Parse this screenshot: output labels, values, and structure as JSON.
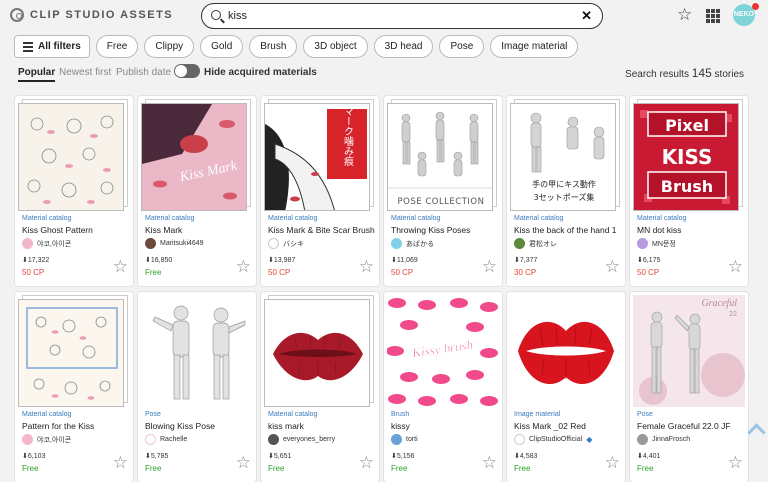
{
  "header": {
    "brand": "CLIP STUDIO ASSETS",
    "search_value": "kiss",
    "avatar_text": "NEKO",
    "colors": {
      "accent": "#3a7bbf",
      "paid": "#e0483a",
      "free": "#2aa02a"
    }
  },
  "filters": [
    "All filters",
    "Free",
    "Clippy",
    "Gold",
    "Brush",
    "3D object",
    "3D head",
    "Pose",
    "Image material"
  ],
  "sort": {
    "options": [
      "Popular",
      "Newest first",
      "Publish date"
    ],
    "active": "Popular",
    "toggle_label": "Hide acquired materials"
  },
  "results": {
    "prefix": "Search results",
    "count": "145",
    "suffix": "stories"
  },
  "cards": [
    {
      "category": "Material catalog",
      "title": "Kiss Ghost Pattern",
      "author": "야코,아이콘",
      "downloads": "17,322",
      "price": "50 CP",
      "paid": true,
      "author_color": "#f4b6c9"
    },
    {
      "category": "Material catalog",
      "title": "Kiss Mark",
      "author": "Maritsuki4649",
      "downloads": "16,850",
      "price": "Free",
      "paid": false,
      "author_color": "#6b4a3a"
    },
    {
      "category": "Material catalog",
      "title": "Kiss Mark & Bite Scar Brush",
      "author": "バシキ",
      "downloads": "13,987",
      "price": "50 CP",
      "paid": true,
      "author_color": "#ffffff"
    },
    {
      "category": "Material catalog",
      "title": "Throwing Kiss Poses",
      "author": "あばかる",
      "downloads": "11,069",
      "price": "50 CP",
      "paid": true,
      "author_color": "#7fd0e8"
    },
    {
      "category": "Material catalog",
      "title": "Kiss the back of the hand 1",
      "author": "君松オレ",
      "downloads": "7,377",
      "price": "30 CP",
      "paid": true,
      "author_color": "#5a8a3a"
    },
    {
      "category": "Material catalog",
      "title": "MN dot kiss",
      "author": "MN문정",
      "downloads": "6,175",
      "price": "50 CP",
      "paid": true,
      "author_color": "#b59ae0"
    },
    {
      "category": "Material catalog",
      "title": "Pattern for the Kiss",
      "author": "야코,아이콘",
      "downloads": "6,103",
      "price": "Free",
      "paid": false,
      "author_color": "#f4b6c9"
    },
    {
      "category": "Pose",
      "title": "Blowing Kiss Pose",
      "author": "Rachelle",
      "downloads": "5,785",
      "price": "Free",
      "paid": false,
      "author_color": "#ffffff"
    },
    {
      "category": "Material catalog",
      "title": "kiss mark",
      "author": "everyones_berry",
      "downloads": "5,651",
      "price": "Free",
      "paid": false,
      "author_color": "#555555"
    },
    {
      "category": "Brush",
      "title": "kissy",
      "author": "torti",
      "downloads": "5,156",
      "price": "Free",
      "paid": false,
      "author_color": "#6aa0d8"
    },
    {
      "category": "Image material",
      "title": "Kiss Mark _02 Red",
      "author": "ClipStudioOfficial",
      "downloads": "4,583",
      "price": "Free",
      "paid": false,
      "author_color": "#ffffff"
    },
    {
      "category": "Pose",
      "title": "Female Graceful 22.0 JF",
      "author": "JinnaFrosch",
      "downloads": "4,401",
      "price": "Free",
      "paid": false,
      "author_color": "#999999"
    }
  ],
  "thumb_text": {
    "t2": "Kiss Mark",
    "t3": "キスマーク噛み痕",
    "t4": "POSE COLLECTION",
    "t5a": "手の甲にキス動作",
    "t5b": "3セットポーズ集",
    "t6": [
      "Pixel",
      "KISS",
      "Brush"
    ],
    "t10": "Kissy brush",
    "t12a": "Graceful",
    "t12b": "22"
  }
}
